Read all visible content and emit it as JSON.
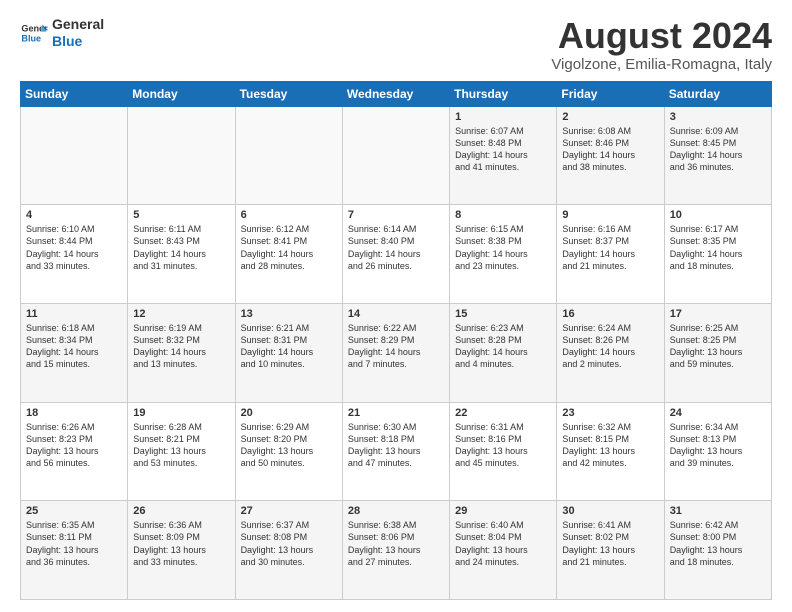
{
  "logo": {
    "line1": "General",
    "line2": "Blue"
  },
  "title": "August 2024",
  "location": "Vigolzone, Emilia-Romagna, Italy",
  "days_header": [
    "Sunday",
    "Monday",
    "Tuesday",
    "Wednesday",
    "Thursday",
    "Friday",
    "Saturday"
  ],
  "weeks": [
    [
      {
        "day": "",
        "content": ""
      },
      {
        "day": "",
        "content": ""
      },
      {
        "day": "",
        "content": ""
      },
      {
        "day": "",
        "content": ""
      },
      {
        "day": "1",
        "content": "Sunrise: 6:07 AM\nSunset: 8:48 PM\nDaylight: 14 hours\nand 41 minutes."
      },
      {
        "day": "2",
        "content": "Sunrise: 6:08 AM\nSunset: 8:46 PM\nDaylight: 14 hours\nand 38 minutes."
      },
      {
        "day": "3",
        "content": "Sunrise: 6:09 AM\nSunset: 8:45 PM\nDaylight: 14 hours\nand 36 minutes."
      }
    ],
    [
      {
        "day": "4",
        "content": "Sunrise: 6:10 AM\nSunset: 8:44 PM\nDaylight: 14 hours\nand 33 minutes."
      },
      {
        "day": "5",
        "content": "Sunrise: 6:11 AM\nSunset: 8:43 PM\nDaylight: 14 hours\nand 31 minutes."
      },
      {
        "day": "6",
        "content": "Sunrise: 6:12 AM\nSunset: 8:41 PM\nDaylight: 14 hours\nand 28 minutes."
      },
      {
        "day": "7",
        "content": "Sunrise: 6:14 AM\nSunset: 8:40 PM\nDaylight: 14 hours\nand 26 minutes."
      },
      {
        "day": "8",
        "content": "Sunrise: 6:15 AM\nSunset: 8:38 PM\nDaylight: 14 hours\nand 23 minutes."
      },
      {
        "day": "9",
        "content": "Sunrise: 6:16 AM\nSunset: 8:37 PM\nDaylight: 14 hours\nand 21 minutes."
      },
      {
        "day": "10",
        "content": "Sunrise: 6:17 AM\nSunset: 8:35 PM\nDaylight: 14 hours\nand 18 minutes."
      }
    ],
    [
      {
        "day": "11",
        "content": "Sunrise: 6:18 AM\nSunset: 8:34 PM\nDaylight: 14 hours\nand 15 minutes."
      },
      {
        "day": "12",
        "content": "Sunrise: 6:19 AM\nSunset: 8:32 PM\nDaylight: 14 hours\nand 13 minutes."
      },
      {
        "day": "13",
        "content": "Sunrise: 6:21 AM\nSunset: 8:31 PM\nDaylight: 14 hours\nand 10 minutes."
      },
      {
        "day": "14",
        "content": "Sunrise: 6:22 AM\nSunset: 8:29 PM\nDaylight: 14 hours\nand 7 minutes."
      },
      {
        "day": "15",
        "content": "Sunrise: 6:23 AM\nSunset: 8:28 PM\nDaylight: 14 hours\nand 4 minutes."
      },
      {
        "day": "16",
        "content": "Sunrise: 6:24 AM\nSunset: 8:26 PM\nDaylight: 14 hours\nand 2 minutes."
      },
      {
        "day": "17",
        "content": "Sunrise: 6:25 AM\nSunset: 8:25 PM\nDaylight: 13 hours\nand 59 minutes."
      }
    ],
    [
      {
        "day": "18",
        "content": "Sunrise: 6:26 AM\nSunset: 8:23 PM\nDaylight: 13 hours\nand 56 minutes."
      },
      {
        "day": "19",
        "content": "Sunrise: 6:28 AM\nSunset: 8:21 PM\nDaylight: 13 hours\nand 53 minutes."
      },
      {
        "day": "20",
        "content": "Sunrise: 6:29 AM\nSunset: 8:20 PM\nDaylight: 13 hours\nand 50 minutes."
      },
      {
        "day": "21",
        "content": "Sunrise: 6:30 AM\nSunset: 8:18 PM\nDaylight: 13 hours\nand 47 minutes."
      },
      {
        "day": "22",
        "content": "Sunrise: 6:31 AM\nSunset: 8:16 PM\nDaylight: 13 hours\nand 45 minutes."
      },
      {
        "day": "23",
        "content": "Sunrise: 6:32 AM\nSunset: 8:15 PM\nDaylight: 13 hours\nand 42 minutes."
      },
      {
        "day": "24",
        "content": "Sunrise: 6:34 AM\nSunset: 8:13 PM\nDaylight: 13 hours\nand 39 minutes."
      }
    ],
    [
      {
        "day": "25",
        "content": "Sunrise: 6:35 AM\nSunset: 8:11 PM\nDaylight: 13 hours\nand 36 minutes."
      },
      {
        "day": "26",
        "content": "Sunrise: 6:36 AM\nSunset: 8:09 PM\nDaylight: 13 hours\nand 33 minutes."
      },
      {
        "day": "27",
        "content": "Sunrise: 6:37 AM\nSunset: 8:08 PM\nDaylight: 13 hours\nand 30 minutes."
      },
      {
        "day": "28",
        "content": "Sunrise: 6:38 AM\nSunset: 8:06 PM\nDaylight: 13 hours\nand 27 minutes."
      },
      {
        "day": "29",
        "content": "Sunrise: 6:40 AM\nSunset: 8:04 PM\nDaylight: 13 hours\nand 24 minutes."
      },
      {
        "day": "30",
        "content": "Sunrise: 6:41 AM\nSunset: 8:02 PM\nDaylight: 13 hours\nand 21 minutes."
      },
      {
        "day": "31",
        "content": "Sunrise: 6:42 AM\nSunset: 8:00 PM\nDaylight: 13 hours\nand 18 minutes."
      }
    ]
  ]
}
